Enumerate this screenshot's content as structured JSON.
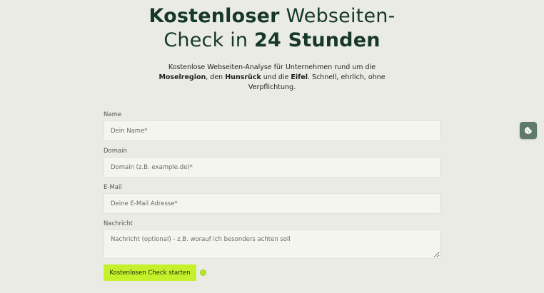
{
  "hero": {
    "title_bold_1": "Kostenloser",
    "title_regular_1": " Webseiten-",
    "title_regular_2": "Check in ",
    "title_bold_2": "24 Stunden",
    "subtitle_part_1": "Kostenlose Webseiten-Analyse für Unternehmen rund um die ",
    "subtitle_bold_1": "Moselregion",
    "subtitle_part_2": ", den ",
    "subtitle_bold_2": "Hunsrück",
    "subtitle_part_3": " und die ",
    "subtitle_bold_3": "Eifel",
    "subtitle_part_4": ". Schnell, ehrlich, ohne Verpflichtung."
  },
  "form": {
    "name": {
      "label": "Name",
      "placeholder": "Dein Name*"
    },
    "domain": {
      "label": "Domain",
      "placeholder": "Domain (z.B. example.de)*"
    },
    "email": {
      "label": "E-Mail",
      "placeholder": "Deine E-Mail Adresse*"
    },
    "message": {
      "label": "Nachricht",
      "placeholder": "Nachricht (optional) - z.B. worauf ich besonders achten soll"
    },
    "submit_label": "Kostenlosen Check starten"
  },
  "icons": {
    "cookie": "cookie-icon"
  },
  "colors": {
    "background": "#ebebe5",
    "title": "#16382a",
    "accent": "#c4f02c",
    "cookie_button": "#5f7a6a"
  }
}
